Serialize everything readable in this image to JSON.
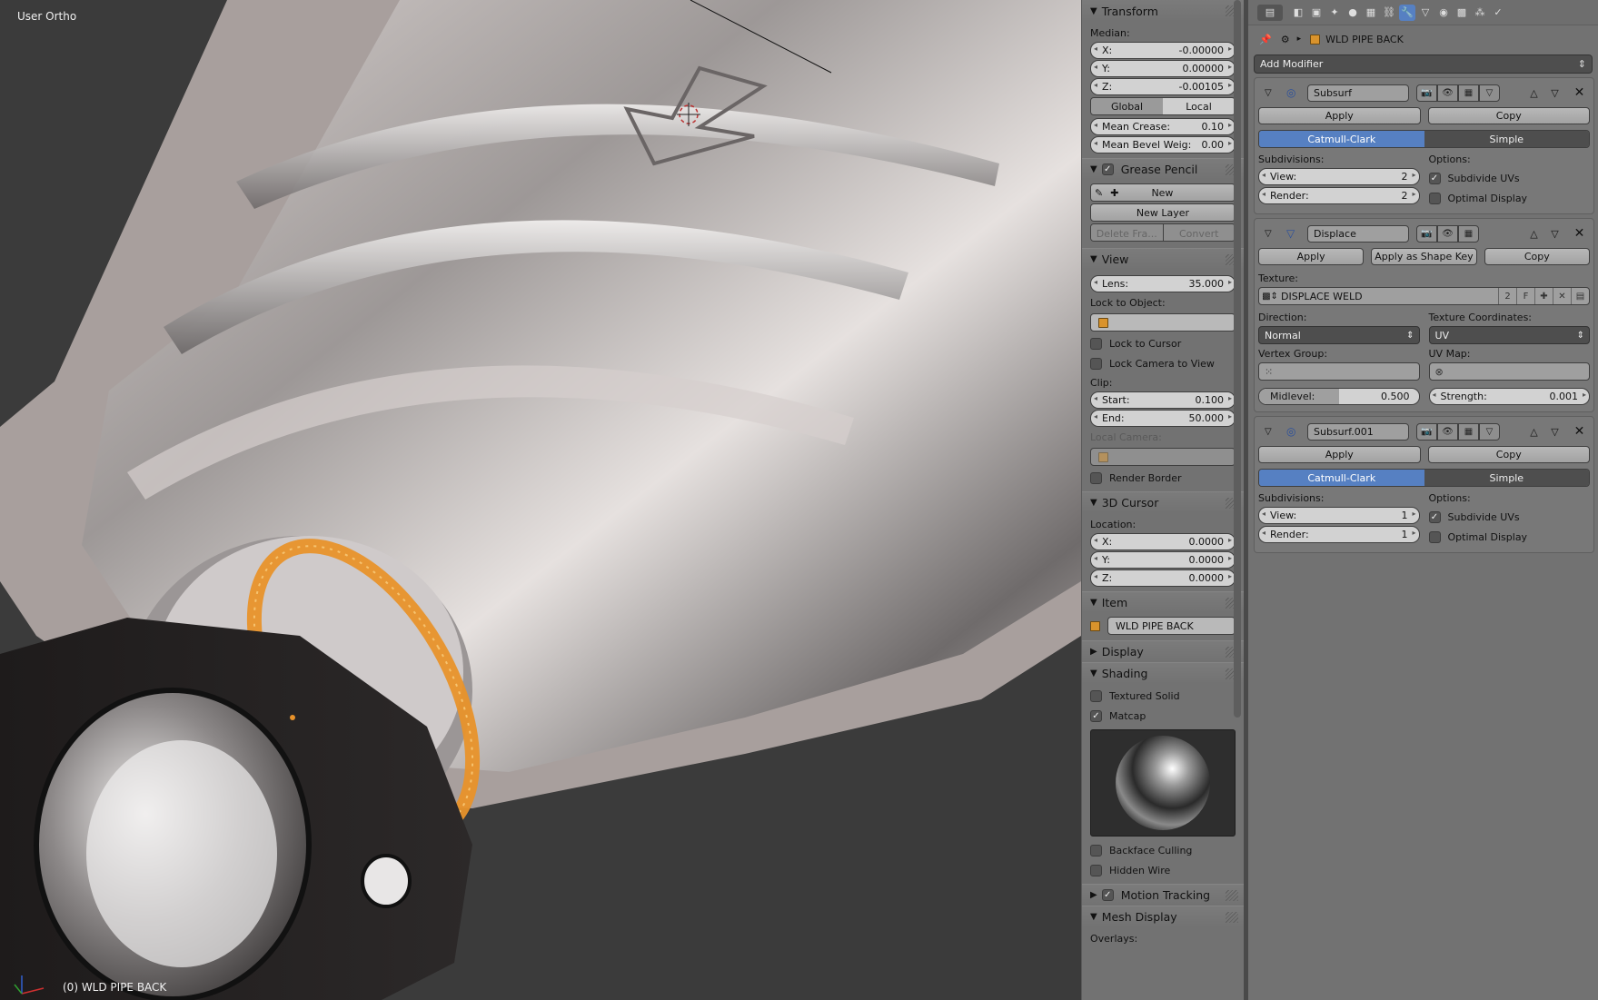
{
  "viewport": {
    "mode_label": "User Ortho",
    "object_label": "(0) WLD PIPE BACK"
  },
  "npanel": {
    "transform": {
      "title": "Transform",
      "median_label": "Median:",
      "x_label": "X:",
      "x_value": "-0.00000",
      "y_label": "Y:",
      "y_value": "0.00000",
      "z_label": "Z:",
      "z_value": "-0.00105",
      "global_label": "Global",
      "local_label": "Local",
      "crease_label": "Mean Crease:",
      "crease_value": "0.10",
      "bevel_label": "Mean Bevel Weig:",
      "bevel_value": "0.00"
    },
    "grease_pencil": {
      "title": "Grease Pencil",
      "new_label": "New",
      "new_layer_label": "New Layer",
      "delete_frame_label": "Delete Fra...",
      "convert_label": "Convert"
    },
    "view": {
      "title": "View",
      "lens_label": "Lens:",
      "lens_value": "35.000",
      "lock_object_label": "Lock to Object:",
      "lock_cursor_label": "Lock to Cursor",
      "lock_camera_label": "Lock Camera to View",
      "clip_label": "Clip:",
      "start_label": "Start:",
      "start_value": "0.100",
      "end_label": "End:",
      "end_value": "50.000",
      "local_camera_label": "Local Camera:",
      "render_border_label": "Render Border"
    },
    "cursor": {
      "title": "3D Cursor",
      "location_label": "Location:",
      "x_label": "X:",
      "x_value": "0.0000",
      "y_label": "Y:",
      "y_value": "0.0000",
      "z_label": "Z:",
      "z_value": "0.0000"
    },
    "item": {
      "title": "Item",
      "name": "WLD PIPE BACK"
    },
    "display": {
      "title": "Display"
    },
    "shading": {
      "title": "Shading",
      "textured_solid_label": "Textured Solid",
      "matcap_label": "Matcap",
      "backface_label": "Backface Culling",
      "hidden_wire_label": "Hidden Wire"
    },
    "motion_tracking": {
      "title": "Motion Tracking"
    },
    "mesh_display": {
      "title": "Mesh Display",
      "overlays_label": "Overlays:"
    }
  },
  "props": {
    "object_name": "WLD PIPE BACK",
    "add_modifier_label": "Add Modifier",
    "mod1": {
      "name": "Subsurf",
      "apply_label": "Apply",
      "copy_label": "Copy",
      "catmull_label": "Catmull-Clark",
      "simple_label": "Simple",
      "subdiv_label": "Subdivisions:",
      "options_label": "Options:",
      "view_label": "View:",
      "view_value": "2",
      "render_label": "Render:",
      "render_value": "2",
      "subdivide_uvs_label": "Subdivide UVs",
      "optimal_label": "Optimal Display"
    },
    "mod2": {
      "name": "Displace",
      "apply_label": "Apply",
      "apply_shape_label": "Apply as Shape Key",
      "copy_label": "Copy",
      "texture_label": "Texture:",
      "texture_name": "DISPLACE WELD",
      "texture_users": "2",
      "texture_f": "F",
      "direction_label": "Direction:",
      "direction_value": "Normal",
      "texcoords_label": "Texture Coordinates:",
      "texcoords_value": "UV",
      "vgroup_label": "Vertex Group:",
      "uvmap_label": "UV Map:",
      "midlevel_label": "Midlevel:",
      "midlevel_value": "0.500",
      "strength_label": "Strength:",
      "strength_value": "0.001"
    },
    "mod3": {
      "name": "Subsurf.001",
      "apply_label": "Apply",
      "copy_label": "Copy",
      "catmull_label": "Catmull-Clark",
      "simple_label": "Simple",
      "subdiv_label": "Subdivisions:",
      "options_label": "Options:",
      "view_label": "View:",
      "view_value": "1",
      "render_label": "Render:",
      "render_value": "1",
      "subdivide_uvs_label": "Subdivide UVs",
      "optimal_label": "Optimal Display"
    }
  },
  "colors": {
    "active_blue": "#5680c2",
    "panel_bg": "#727272",
    "viewport_bg": "#3b3b3b",
    "selection_orange": "#e8922a"
  }
}
